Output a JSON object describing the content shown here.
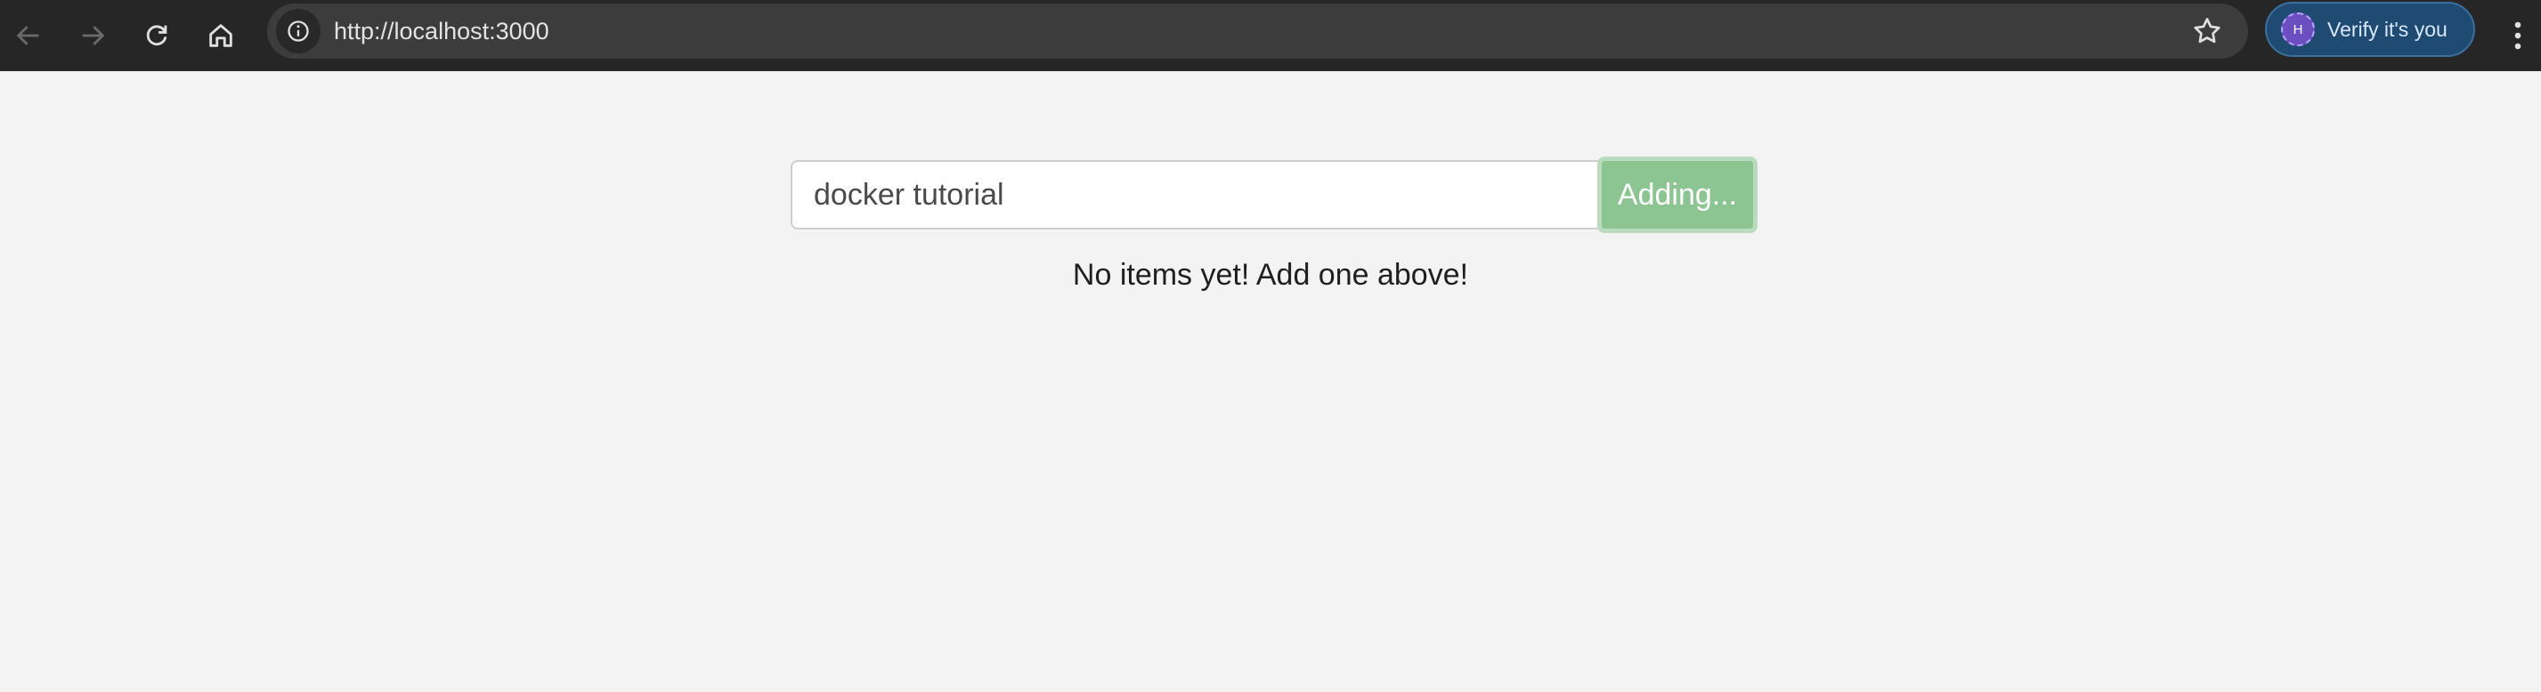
{
  "browser": {
    "url": "http://localhost:3000",
    "profile_initial": "H",
    "verify_label": "Verify it's you",
    "icons": {
      "back": "arrow-left-icon",
      "forward": "arrow-right-icon",
      "reload": "reload-icon",
      "home": "home-icon",
      "site_info": "info-icon",
      "bookmark": "star-icon",
      "menu": "kebab-menu-icon"
    }
  },
  "app": {
    "input_value": "docker tutorial",
    "button_label": "Adding...",
    "empty_message": "No items yet! Add one above!"
  },
  "colors": {
    "toolbar_bg": "#262626",
    "page_bg": "#f3f3f3",
    "button_bg": "#8cc592",
    "verify_bg": "#1f4a72"
  }
}
